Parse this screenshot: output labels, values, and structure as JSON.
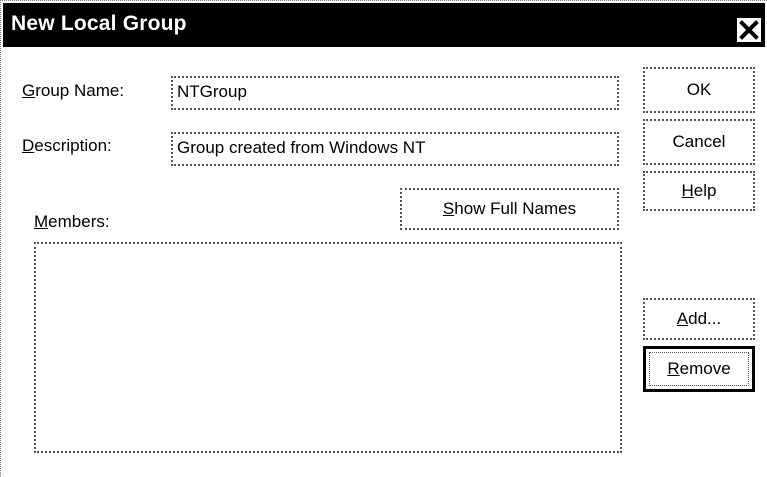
{
  "window": {
    "title": "New Local Group",
    "close_label": "X"
  },
  "form": {
    "group_name": {
      "mnemonic": "G",
      "label_rest": "roup Name:",
      "value": "NTGroup"
    },
    "description": {
      "mnemonic": "D",
      "label_rest": "escription:",
      "value": "Group created from Windows NT"
    },
    "members": {
      "mnemonic": "M",
      "label_rest": "embers:",
      "items": []
    }
  },
  "buttons": {
    "ok": "OK",
    "cancel": "Cancel",
    "help_mnemonic": "H",
    "help_rest": "elp",
    "show_full_names_mnemonic": "S",
    "show_full_names_rest": "how Full Names",
    "add_mnemonic": "A",
    "add_rest": "dd...",
    "remove_mnemonic": "R",
    "remove_rest": "emove"
  },
  "colors": {
    "titlebar_bg": "#000000",
    "titlebar_text": "#ffffff",
    "background": "#ffffff"
  }
}
